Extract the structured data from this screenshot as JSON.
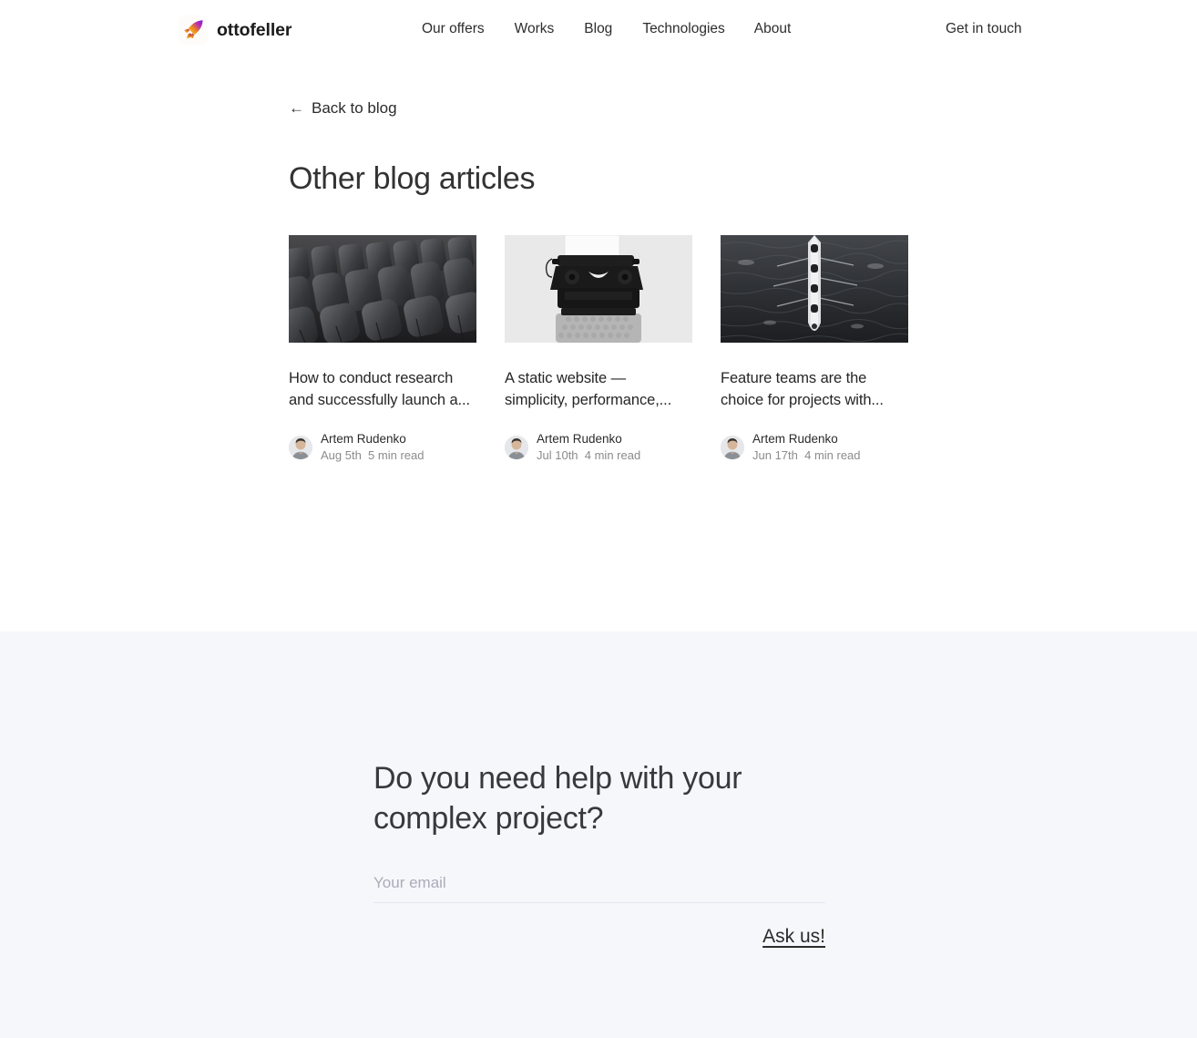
{
  "header": {
    "brand_name": "ottofeller",
    "logo_icon": "rocket-icon",
    "nav": [
      {
        "label": "Our offers"
      },
      {
        "label": "Works"
      },
      {
        "label": "Blog"
      },
      {
        "label": "Technologies"
      },
      {
        "label": "About"
      }
    ],
    "cta": "Get in touch"
  },
  "main": {
    "back_link": {
      "arrow": "←",
      "label": "Back to blog"
    },
    "section_title": "Other blog articles",
    "articles": [
      {
        "title": "How to conduct research and successfully launch a...",
        "author": "Artem Rudenko",
        "date": "Aug 5th",
        "read_time": "5 min read",
        "meta_line": "Aug 5th  5 min read",
        "image_alt": "rows-of-dark-chairs",
        "image_icon": "chairs-photo"
      },
      {
        "title": "A static website — simplicity, performance,...",
        "author": "Artem Rudenko",
        "date": "Jul 10th",
        "read_time": "4 min read",
        "meta_line": "Jul 10th  4 min read",
        "image_alt": "vintage-typewriter",
        "image_icon": "typewriter-photo"
      },
      {
        "title": "Feature teams are the choice for projects with...",
        "author": "Artem Rudenko",
        "date": "Jun 17th",
        "read_time": "4 min read",
        "meta_line": "Jun 17th  4 min read",
        "image_alt": "rowing-crew-aerial",
        "image_icon": "rowing-boat-photo"
      }
    ]
  },
  "cta_section": {
    "heading": "Do you need help with your complex project?",
    "email_placeholder": "Your email",
    "email_value": "",
    "submit_label": "Ask us!"
  },
  "colors": {
    "page_background": "#ffffff",
    "cta_background": "#f6f7fb",
    "text_primary": "#2b2b2b",
    "text_muted": "#8b8b8b",
    "input_underline": "#e3e6ef",
    "logo_gradient_start": "#f5c518",
    "logo_gradient_mid": "#f2711c",
    "logo_gradient_end": "#8c24c4"
  }
}
